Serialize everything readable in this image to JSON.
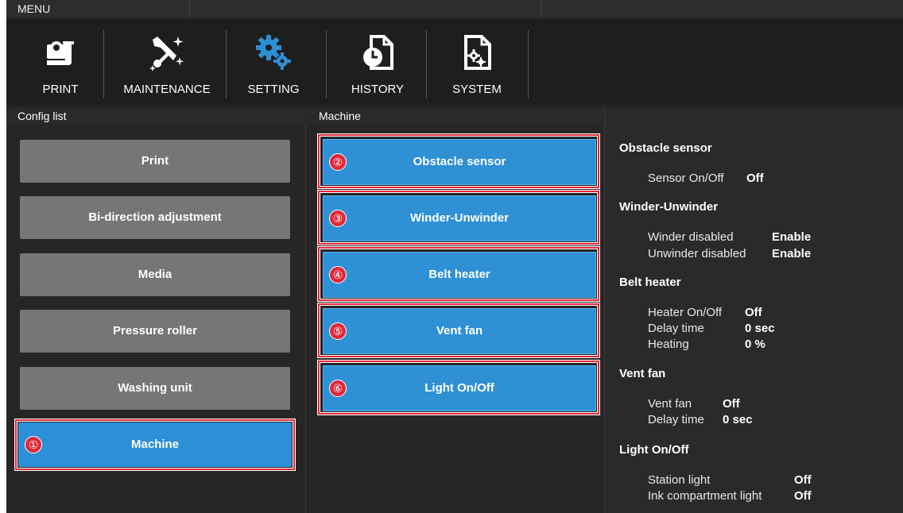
{
  "menu_bar": {
    "title": "MENU"
  },
  "toolbar": {
    "items": [
      {
        "label": "PRINT",
        "icon": "print-roll-icon"
      },
      {
        "label": "MAINTENANCE",
        "icon": "tools-icon"
      },
      {
        "label": "SETTING",
        "icon": "gears-icon",
        "active": true
      },
      {
        "label": "HISTORY",
        "icon": "clock-document-icon"
      },
      {
        "label": "SYSTEM",
        "icon": "gear-document-icon"
      }
    ],
    "active_color": "#2d8fd6"
  },
  "config_list": {
    "header": "Config list",
    "items": [
      {
        "label": "Print"
      },
      {
        "label": "Bi-direction adjustment"
      },
      {
        "label": "Media"
      },
      {
        "label": "Pressure roller"
      },
      {
        "label": "Washing unit"
      },
      {
        "label": "Machine",
        "active": true,
        "marker": "①"
      }
    ]
  },
  "machine": {
    "header": "Machine",
    "items": [
      {
        "label": "Obstacle sensor",
        "marker": "②"
      },
      {
        "label": "Winder-Unwinder",
        "marker": "③"
      },
      {
        "label": "Belt heater",
        "marker": "④"
      },
      {
        "label": "Vent fan",
        "marker": "⑤"
      },
      {
        "label": "Light On/Off",
        "marker": "⑥"
      }
    ]
  },
  "details": {
    "sections": [
      {
        "title": "Obstacle sensor",
        "rows": [
          {
            "key": "Sensor On/Off",
            "value": "Off"
          }
        ]
      },
      {
        "title": "Winder-Unwinder",
        "rows": [
          {
            "key": "Winder disabled",
            "value": "Enable"
          },
          {
            "key": "Unwinder disabled",
            "value": "Enable"
          }
        ]
      },
      {
        "title": "Belt heater",
        "rows": [
          {
            "key": "Heater On/Off",
            "value": "Off"
          },
          {
            "key": "Delay time",
            "value": "0 sec"
          },
          {
            "key": "Heating",
            "value": "0 %"
          }
        ]
      },
      {
        "title": "Vent fan",
        "rows": [
          {
            "key": "Vent fan",
            "value": "Off"
          },
          {
            "key": "Delay time",
            "value": "0 sec"
          }
        ]
      },
      {
        "title": "Light On/Off",
        "rows": [
          {
            "key": "Station light",
            "value": "Off"
          },
          {
            "key": "Ink compartment light",
            "value": "Off"
          }
        ]
      }
    ]
  },
  "colors": {
    "background": "#252525",
    "button_gray": "#767676",
    "button_blue": "#2f90d5",
    "highlight": "#e0293b"
  }
}
